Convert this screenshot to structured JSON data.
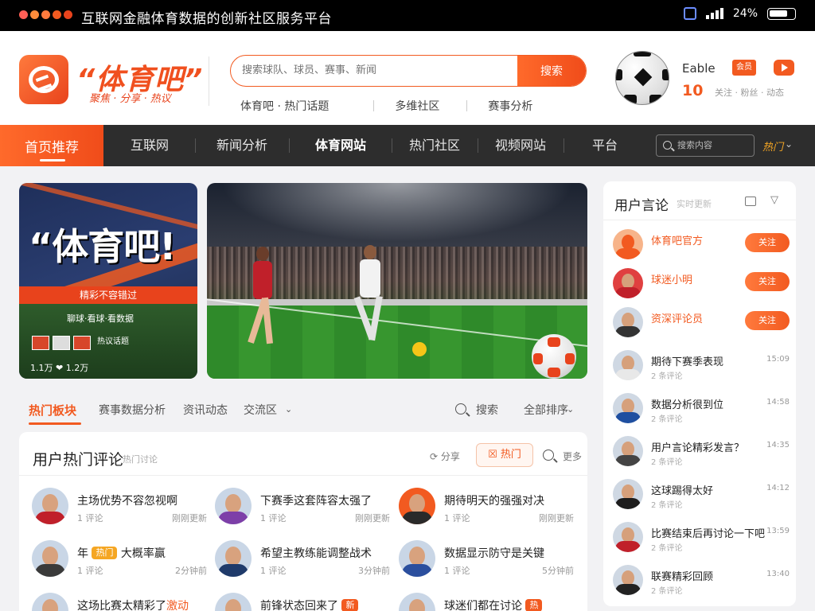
{
  "window": {
    "title": "互联网金融体育数据的创新社区服务平台",
    "dot_colors": [
      "#ff5f56",
      "#ff8c3a",
      "#ff7a3d",
      "#f25a20",
      "#e8431c"
    ],
    "time": "24%"
  },
  "header": {
    "brand": "“体育吧”",
    "brand_sub": "聚焦 · 分享 · 热议",
    "search_placeholder": "搜索球队、球员、赛事、新闻",
    "search_button": "搜索",
    "subnav": [
      "体育吧 · 热门话题",
      "多维社区",
      "赛事分析"
    ],
    "user_name": "Eable",
    "user_num": "10",
    "user_note": "关注 · 粉丝 · 动态",
    "badge": "会员"
  },
  "nav": {
    "active": "首页推荐",
    "items": [
      "互联网",
      "新闻分析",
      "体育网站",
      "热门社区",
      "视频网站",
      "平台"
    ],
    "search_placeholder": "搜索内容",
    "extra": "热门"
  },
  "promo": {
    "title": "“体育吧!",
    "band": "精彩不容错过",
    "line": "聊球·看球·看数据",
    "tag": "热议话题",
    "stats": "1.1万 ❤ 1.2万"
  },
  "section_tabs": {
    "tabs": [
      "热门板块",
      "赛事数据分析",
      "资讯动态",
      "交流区"
    ],
    "search_label": "搜索",
    "sort_label": "全部排序"
  },
  "comments": {
    "title": "用户热门评论",
    "tag": "热门讨论",
    "share_label": "分享",
    "hot_label": "热门",
    "more_label": "更多",
    "items": [
      {
        "text": "主场优势不容忽视啊",
        "meta": "1 评论",
        "right": "刚刚更新",
        "shirt": "#c0202a"
      },
      {
        "text": "下赛季这套阵容太强了",
        "meta": "1 评论",
        "right": "刚刚更新",
        "shirt": "#7d3fa8"
      },
      {
        "text": "期待明天的强强对决",
        "meta": "1 评论",
        "right": "刚刚更新",
        "shirt": "#2a2a2a"
      },
      {
        "text": "年",
        "pill": "热门",
        "text2": "大概率赢",
        "meta": "1 评论",
        "right": "2分钟前",
        "shirt": "#3a3a3a"
      },
      {
        "text": "希望主教练能调整战术",
        "meta": "1 评论",
        "right": "3分钟前",
        "shirt": "#1f3a6a"
      },
      {
        "text": "数据显示防守是关键",
        "meta": "1 评论",
        "right": "5分钟前",
        "shirt": "#2b4f9e"
      },
      {
        "text": "这场比赛太精彩了",
        "hl": "激动",
        "meta": "",
        "right": "",
        "shirt": "#c0202a"
      },
      {
        "text": "前锋状态回来了",
        "pill": "新",
        "meta": "",
        "right": "",
        "shirt": "#2ba0c8"
      },
      {
        "text": "球迷们都在讨论",
        "pill": "热",
        "meta": "",
        "right": "",
        "shirt": "#333"
      }
    ]
  },
  "sidebar": {
    "title": "用户言论",
    "sub": "实时更新",
    "follow_label": "关注",
    "rows": [
      {
        "name": "体育吧官方",
        "org": true,
        "btn": true,
        "shirt": "#f25a20"
      },
      {
        "name": "球迷小明",
        "org": true,
        "btn": true,
        "shirt": "#c0202a"
      },
      {
        "name": "资深评论员",
        "org": true,
        "btn": true,
        "shirt": "#333"
      },
      {
        "name": "期待下赛季表现",
        "sub": "2 条评论",
        "date": "15:09",
        "shirt": "#e8e8e8"
      },
      {
        "name": "数据分析很到位",
        "sub": "2 条评论",
        "date": "14:58",
        "shirt": "#1f4fa0"
      },
      {
        "name": "用户言论精彩发言？",
        "sub": "2 条评论",
        "date": "14:35",
        "shirt": "#444"
      },
      {
        "name": "这球踢得太好",
        "sub": "2 条评论",
        "date": "14:12",
        "shirt": "#1d1d1d"
      },
      {
        "name": "比赛结束后再讨论一下吧",
        "sub": "2 条评论",
        "date": "13:59",
        "shirt": "#c0202a"
      },
      {
        "name": "联赛精彩回顾",
        "sub": "2 条评论",
        "date": "13:40",
        "shirt": "#222"
      }
    ]
  }
}
